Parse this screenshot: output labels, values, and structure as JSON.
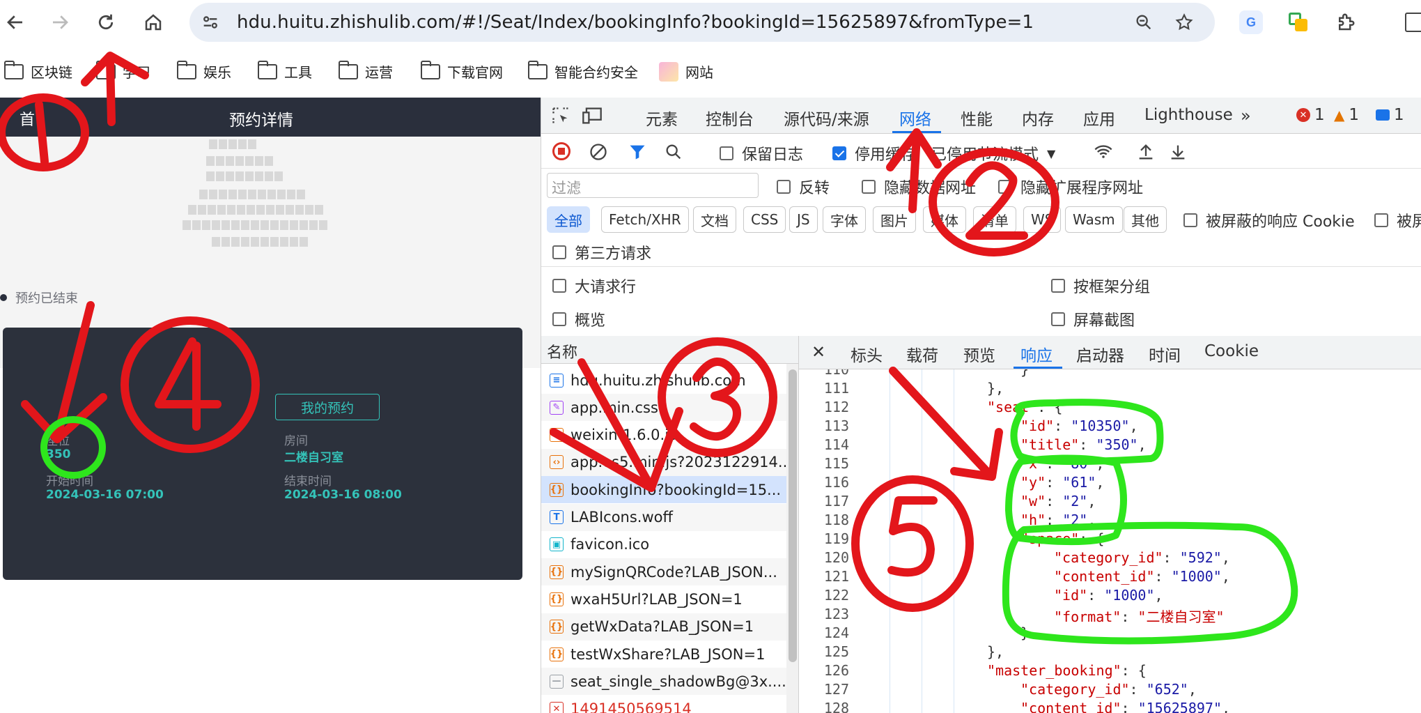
{
  "browser": {
    "url": "hdu.huitu.zhishulib.com/#!/Seat/Index/bookingInfo?bookingId=15625897&fromType=1",
    "bookmarks": [
      "区块链",
      "学习",
      "娱乐",
      "工具",
      "运营",
      "下载官网",
      "智能合约安全",
      "网站"
    ]
  },
  "page": {
    "home_label": "首",
    "title": "预约详情",
    "status": "预约已结束",
    "my_booking_button": "我的预约",
    "seat_label": "座位",
    "seat_value": "350",
    "room_label": "房间",
    "room_value": "二楼自习室",
    "start_label": "开始时间",
    "start_value": "2024-03-16 07:00",
    "end_label": "结束时间",
    "end_value": "2024-03-16 08:00"
  },
  "devtools": {
    "tabs": [
      "元素",
      "控制台",
      "源代码/来源",
      "网络",
      "性能",
      "内存",
      "应用",
      "Lighthouse"
    ],
    "active_tab": "网络",
    "more": "»",
    "errors": "1",
    "warnings": "1",
    "messages": "1",
    "toolbar": {
      "preserve_log": "保留日志",
      "disable_cache": "停用缓存",
      "throttle": "已停用节流模式"
    },
    "filter_placeholder": "过滤",
    "invert": "反转",
    "hide_data_urls": "隐藏数据网址",
    "hide_extension_urls": "隐藏扩展程序网址",
    "types": [
      "全部",
      "Fetch/XHR",
      "文档",
      "CSS",
      "JS",
      "字体",
      "图片",
      "媒体",
      "清单",
      "WS",
      "Wasm",
      "其他"
    ],
    "blocked_cookies": "被屏蔽的响应 Cookie",
    "blocked_requests": "被屏",
    "third_party": "第三方请求",
    "big_rows": "大请求行",
    "group_by_frame": "按框架分组",
    "overview": "概览",
    "screenshots": "屏幕截图",
    "name_header": "名称",
    "requests": [
      "hdu.huitu.zhishulib.com",
      "app.min.css",
      "weixin-1.6.0.js",
      "app.es5.min.js?2023122914...",
      "bookingInfo?bookingId=15...",
      "LABIcons.woff",
      "favicon.ico",
      "mySignQRCode?LAB_JSON...",
      "wxaH5Url?LAB_JSON=1",
      "getWxData?LAB_JSON=1",
      "testWxShare?LAB_JSON=1",
      "seat_single_shadowBg@3x....",
      "1491450569514"
    ],
    "detail_tabs": [
      "标头",
      "载荷",
      "预览",
      "响应",
      "启动器",
      "时间",
      "Cookie"
    ],
    "active_detail_tab": "响应",
    "code_lines": [
      {
        "n": "110",
        "indent": 5,
        "parts": [
          [
            "pun",
            "}"
          ]
        ]
      },
      {
        "n": "111",
        "indent": 4,
        "parts": [
          [
            "pun",
            "},"
          ]
        ]
      },
      {
        "n": "112",
        "indent": 4,
        "parts": [
          [
            "key",
            "\"seat\""
          ],
          [
            "pun",
            ": {"
          ]
        ]
      },
      {
        "n": "113",
        "indent": 5,
        "parts": [
          [
            "key",
            "\"id\""
          ],
          [
            "pun",
            ": "
          ],
          [
            "str",
            "\"10350\""
          ],
          [
            "pun",
            ","
          ]
        ]
      },
      {
        "n": "114",
        "indent": 5,
        "parts": [
          [
            "key",
            "\"title\""
          ],
          [
            "pun",
            ": "
          ],
          [
            "str",
            "\"350\""
          ],
          [
            "pun",
            ","
          ]
        ]
      },
      {
        "n": "115",
        "indent": 5,
        "parts": [
          [
            "key",
            "\"x\""
          ],
          [
            "pun",
            ": "
          ],
          [
            "str",
            "\"80\""
          ],
          [
            "pun",
            ","
          ]
        ]
      },
      {
        "n": "116",
        "indent": 5,
        "parts": [
          [
            "key",
            "\"y\""
          ],
          [
            "pun",
            ": "
          ],
          [
            "str",
            "\"61\""
          ],
          [
            "pun",
            ","
          ]
        ]
      },
      {
        "n": "117",
        "indent": 5,
        "parts": [
          [
            "key",
            "\"w\""
          ],
          [
            "pun",
            ": "
          ],
          [
            "str",
            "\"2\""
          ],
          [
            "pun",
            ","
          ]
        ]
      },
      {
        "n": "118",
        "indent": 5,
        "parts": [
          [
            "key",
            "\"h\""
          ],
          [
            "pun",
            ": "
          ],
          [
            "str",
            "\"2\""
          ],
          [
            "pun",
            ","
          ]
        ]
      },
      {
        "n": "119",
        "indent": 5,
        "parts": [
          [
            "key",
            "\"space\""
          ],
          [
            "pun",
            ": {"
          ]
        ]
      },
      {
        "n": "120",
        "indent": 6,
        "parts": [
          [
            "key",
            "\"category_id\""
          ],
          [
            "pun",
            ": "
          ],
          [
            "str",
            "\"592\""
          ],
          [
            "pun",
            ","
          ]
        ]
      },
      {
        "n": "121",
        "indent": 6,
        "parts": [
          [
            "key",
            "\"content_id\""
          ],
          [
            "pun",
            ": "
          ],
          [
            "str",
            "\"1000\""
          ],
          [
            "pun",
            ","
          ]
        ]
      },
      {
        "n": "122",
        "indent": 6,
        "parts": [
          [
            "key",
            "\"id\""
          ],
          [
            "pun",
            ": "
          ],
          [
            "str",
            "\"1000\""
          ],
          [
            "pun",
            ","
          ]
        ]
      },
      {
        "n": "123",
        "indent": 6,
        "parts": [
          [
            "key",
            "\"format\""
          ],
          [
            "pun",
            ": "
          ],
          [
            "strzh",
            "\"二楼自习室\""
          ]
        ]
      },
      {
        "n": "124",
        "indent": 5,
        "parts": [
          [
            "pun",
            "}"
          ]
        ]
      },
      {
        "n": "125",
        "indent": 4,
        "parts": [
          [
            "pun",
            "},"
          ]
        ]
      },
      {
        "n": "126",
        "indent": 4,
        "parts": [
          [
            "key",
            "\"master_booking\""
          ],
          [
            "pun",
            ": {"
          ]
        ]
      },
      {
        "n": "127",
        "indent": 5,
        "parts": [
          [
            "key",
            "\"category_id\""
          ],
          [
            "pun",
            ": "
          ],
          [
            "str",
            "\"652\""
          ],
          [
            "pun",
            ","
          ]
        ]
      },
      {
        "n": "128",
        "indent": 5,
        "parts": [
          [
            "key",
            "\"content_id\""
          ],
          [
            "pun",
            ": "
          ],
          [
            "str",
            "\"15625897\""
          ],
          [
            "pun",
            ","
          ]
        ]
      }
    ]
  },
  "annotations": {
    "marker_color": "#e3161b",
    "highlight_color": "#2ee61c",
    "labels": [
      "1",
      "2",
      "3",
      "4",
      "5"
    ]
  }
}
